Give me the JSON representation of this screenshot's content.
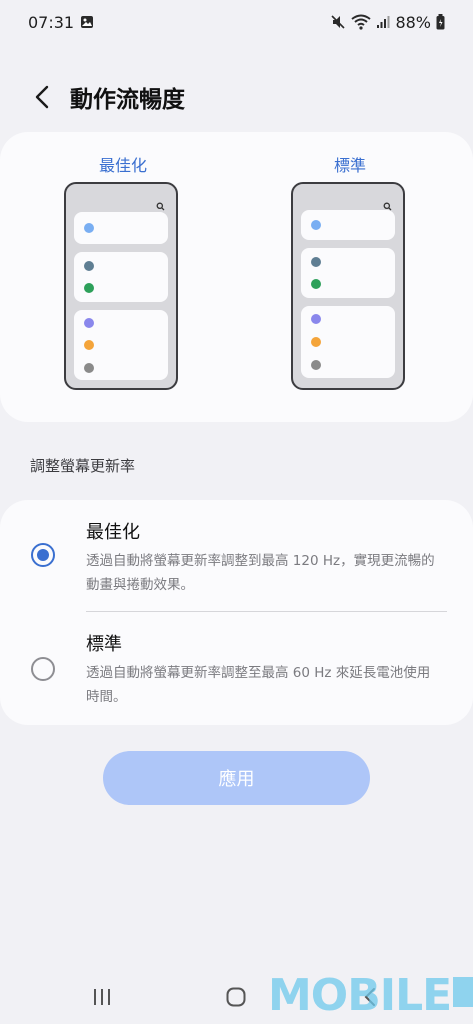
{
  "status_bar": {
    "time": "07:31",
    "battery": "88%",
    "icons": [
      "gallery-notification-icon",
      "mute-icon",
      "wifi-icon",
      "signal-icon",
      "battery-icon"
    ]
  },
  "header": {
    "back_icon": "back-arrow-icon",
    "title": "動作流暢度"
  },
  "preview": {
    "left_label": "最佳化",
    "right_label": "標準",
    "dot_colors": [
      "#79aef2",
      "#5f7e93",
      "#2da05a",
      "#8a87ec",
      "#f4a43a",
      "#8a8a8a"
    ]
  },
  "section": {
    "label": "調整螢幕更新率"
  },
  "options": [
    {
      "title": "最佳化",
      "description": "透過自動將螢幕更新率調整到最高 120 Hz，實現更流暢的動畫與捲動效果。",
      "selected": true
    },
    {
      "title": "標準",
      "description": "透過自動將螢幕更新率調整至最高 60 Hz 來延長電池使用時間。",
      "selected": false
    }
  ],
  "apply_button": {
    "label": "應用",
    "enabled": false
  },
  "nav_bar": {
    "icons": [
      "recents-icon",
      "home-icon",
      "back-icon"
    ]
  },
  "watermark": {
    "text": "MOBILE"
  },
  "colors": {
    "accent": "#3a6fd0",
    "button_disabled": "#aec6f8",
    "background": "#f1f1f5",
    "card": "#fbfbfd"
  }
}
